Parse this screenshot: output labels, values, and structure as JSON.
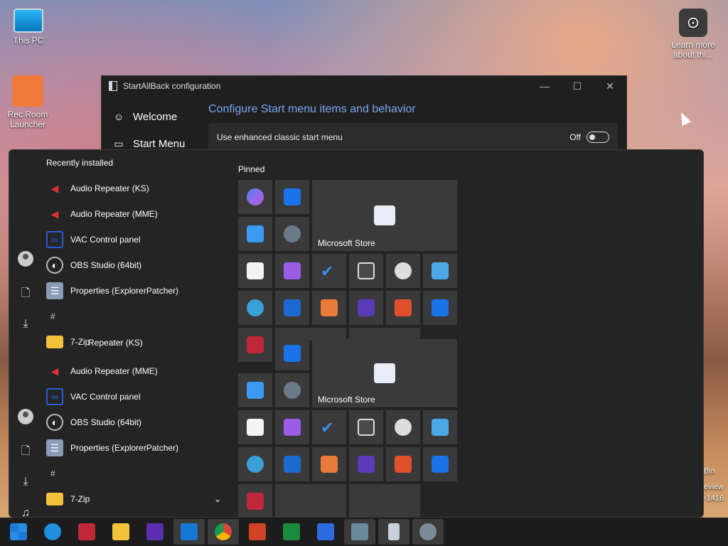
{
  "desktop": {
    "icons": [
      {
        "label": "This PC"
      },
      {
        "label": "Rec Room Launcher"
      },
      {
        "label": "Learn more about thi..."
      }
    ],
    "edge_fragments": [
      "Bin",
      "eview",
      "-1416"
    ]
  },
  "config_window": {
    "title": "StartAllBack configuration",
    "controls": [
      "—",
      "☐",
      "✕"
    ],
    "nav": [
      {
        "label": "Welcome",
        "icon": "smile-icon"
      },
      {
        "label": "Start Menu",
        "icon": "window-icon"
      }
    ],
    "heading": "Configure Start menu items and behavior",
    "option": {
      "label": "Use enhanced classic start menu",
      "state": "Off"
    }
  },
  "start_menu": {
    "recently_installed_label": "Recently installed",
    "pinned_label": "Pinned",
    "apps": [
      {
        "label": "Audio Repeater (KS)",
        "color": "#e03030"
      },
      {
        "label": "Audio Repeater (MME)",
        "color": "#e03030"
      },
      {
        "label": "VAC Control panel",
        "color": "#2a5bd8"
      },
      {
        "label": "OBS Studio (64bit)",
        "color": "#3a3a3a"
      },
      {
        "label": "Properties (ExplorerPatcher)",
        "color": "#8a9bb8"
      }
    ],
    "hash_letter": "#",
    "zip_app": "7-Zip",
    "ghost_app_0": "7-Zip",
    "ghost_app_1": "Repeater (KS)",
    "store_tile": "Microsoft Store",
    "expand_icon": "⌄"
  },
  "taskbar": {
    "items": [
      {
        "name": "start-button",
        "color": "#2b8ce8"
      },
      {
        "name": "edge-preview",
        "color": "#1f8fe0"
      },
      {
        "name": "news-app",
        "color": "#c0283a"
      },
      {
        "name": "file-explorer",
        "color": "#f2c23a"
      },
      {
        "name": "purple-app",
        "color": "#5b2fb0"
      },
      {
        "name": "blue-app",
        "color": "#1477d4"
      },
      {
        "name": "chrome",
        "color": "#db4437"
      },
      {
        "name": "office-app",
        "color": "#d04423"
      },
      {
        "name": "calculator",
        "color": "#1a8a3c"
      },
      {
        "name": "camera-app",
        "color": "#2c6be0"
      },
      {
        "name": "control-app",
        "color": "#6b8a9b"
      },
      {
        "name": "notepad-app",
        "color": "#c8d0db"
      },
      {
        "name": "settings",
        "color": "#7a8a9a"
      }
    ]
  }
}
